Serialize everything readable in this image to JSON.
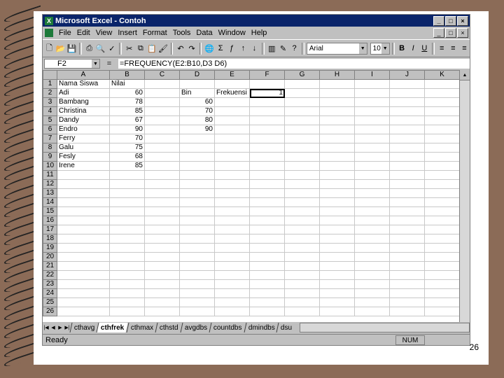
{
  "window": {
    "title": "Microsoft Excel - Contoh"
  },
  "menu": [
    "File",
    "Edit",
    "View",
    "Insert",
    "Format",
    "Tools",
    "Data",
    "Window",
    "Help"
  ],
  "toolbar": {
    "font": "Arial",
    "size": "10"
  },
  "formula_bar": {
    "name_box": "F2",
    "equals": "=",
    "formula": "=FREQUENCY(E2:B10,D3 D6)"
  },
  "grid": {
    "columns": [
      "A",
      "B",
      "C",
      "D",
      "E",
      "F",
      "G",
      "H",
      "I",
      "J",
      "K"
    ],
    "rows": [
      [
        "Nama Siswa",
        "Nilai",
        "",
        "",
        "",
        ""
      ],
      [
        "Adi",
        "60",
        "",
        "Bin",
        "Frekuensi",
        "1"
      ],
      [
        "Bambang",
        "78",
        "",
        "60",
        "",
        ""
      ],
      [
        "Christina",
        "85",
        "",
        "70",
        "",
        ""
      ],
      [
        "Dandy",
        "67",
        "",
        "80",
        "",
        ""
      ],
      [
        "Endro",
        "90",
        "",
        "90",
        "",
        ""
      ],
      [
        "Ferry",
        "70",
        "",
        "",
        "",
        ""
      ],
      [
        "Galu",
        "75",
        "",
        "",
        "",
        ""
      ],
      [
        "Fesly",
        "68",
        "",
        "",
        "",
        ""
      ],
      [
        "Irene",
        "85",
        "",
        "",
        "",
        ""
      ],
      [
        "",
        "",
        "",
        "",
        "",
        ""
      ],
      [
        "",
        "",
        "",
        "",
        "",
        ""
      ],
      [
        "",
        "",
        "",
        "",
        "",
        ""
      ],
      [
        "",
        "",
        "",
        "",
        "",
        ""
      ],
      [
        "",
        "",
        "",
        "",
        "",
        ""
      ],
      [
        "",
        "",
        "",
        "",
        "",
        ""
      ],
      [
        "",
        "",
        "",
        "",
        "",
        ""
      ],
      [
        "",
        "",
        "",
        "",
        "",
        ""
      ],
      [
        "",
        "",
        "",
        "",
        "",
        ""
      ],
      [
        "",
        "",
        "",
        "",
        "",
        ""
      ],
      [
        "",
        "",
        "",
        "",
        "",
        ""
      ],
      [
        "",
        "",
        "",
        "",
        "",
        ""
      ],
      [
        "",
        "",
        "",
        "",
        "",
        ""
      ],
      [
        "",
        "",
        "",
        "",
        "",
        ""
      ],
      [
        "",
        "",
        "",
        "",
        "",
        ""
      ],
      [
        "",
        "",
        "",
        "",
        "",
        ""
      ]
    ]
  },
  "sheet_tabs": [
    "cthavg",
    "cthfrek",
    "cthmax",
    "cthstd",
    "avgdbs",
    "countdbs",
    "dmindbs",
    "dsu"
  ],
  "active_tab": "cthfrek",
  "status": {
    "text": "Ready",
    "indicator": "NUM"
  },
  "page_number": "26"
}
